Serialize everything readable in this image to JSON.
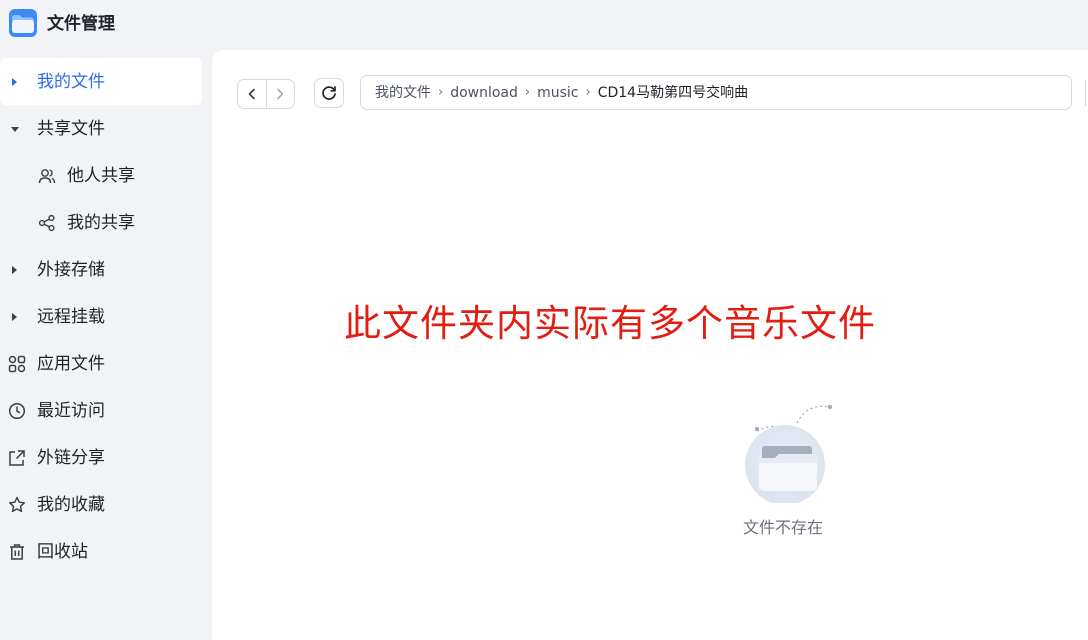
{
  "app": {
    "title": "文件管理",
    "brand_color": "#4a90f0",
    "accent_color": "#2b6de8"
  },
  "sidebar": {
    "items": [
      {
        "label": "我的文件",
        "icon": "caret-right",
        "active": true
      },
      {
        "label": "共享文件",
        "icon": "caret-down"
      },
      {
        "label": "他人共享",
        "icon": "users-icon",
        "sub": true
      },
      {
        "label": "我的共享",
        "icon": "share-icon",
        "sub": true
      },
      {
        "label": "外接存储",
        "icon": "caret-right"
      },
      {
        "label": "远程挂载",
        "icon": "caret-right"
      },
      {
        "label": "应用文件",
        "icon": "apps-icon"
      },
      {
        "label": "最近访问",
        "icon": "clock-icon"
      },
      {
        "label": "外链分享",
        "icon": "external-share-icon"
      },
      {
        "label": "我的收藏",
        "icon": "star-icon"
      },
      {
        "label": "回收站",
        "icon": "trash-icon"
      }
    ]
  },
  "toolbar": {
    "back_icon": "chevron-left-icon",
    "forward_icon": "chevron-right-icon",
    "refresh_icon": "refresh-icon"
  },
  "breadcrumb": {
    "items": [
      "我的文件",
      "download",
      "music",
      "CD14马勒第四号交响曲"
    ],
    "separator": "›"
  },
  "main": {
    "annotation": "此文件夹内实际有多个音乐文件",
    "annotation_color": "#e21d12",
    "empty_text": "文件不存在"
  }
}
